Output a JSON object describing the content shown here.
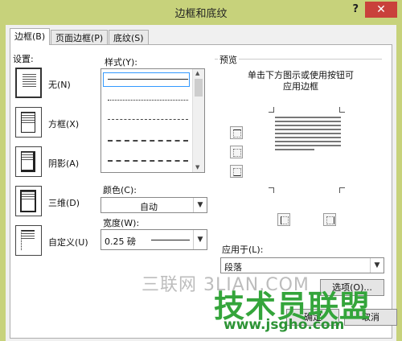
{
  "window": {
    "title": "边框和底纹",
    "help": "?",
    "close": "✕"
  },
  "tabs": [
    "边框(B)",
    "页面边框(P)",
    "底纹(S)"
  ],
  "setting": {
    "label": "设置:",
    "presets": [
      "无(N)",
      "方框(X)",
      "阴影(A)",
      "三维(D)",
      "自定义(U)"
    ]
  },
  "style": {
    "label": "样式(Y):"
  },
  "color": {
    "label": "颜色(C):",
    "value": "自动"
  },
  "width": {
    "label": "宽度(W):",
    "value": "0.25 磅"
  },
  "preview": {
    "label": "预览",
    "hint_line1": "单击下方图示或使用按钮可",
    "hint_line2": "应用边框"
  },
  "apply": {
    "label": "应用于(L):",
    "value": "段落"
  },
  "buttons": {
    "options": "选项(O)...",
    "ok": "确定",
    "cancel": "取消"
  },
  "watermark": {
    "line1": "三联网 3LIAN.COM",
    "brand": "技术员联盟",
    "url": "www.jsgho.com"
  }
}
